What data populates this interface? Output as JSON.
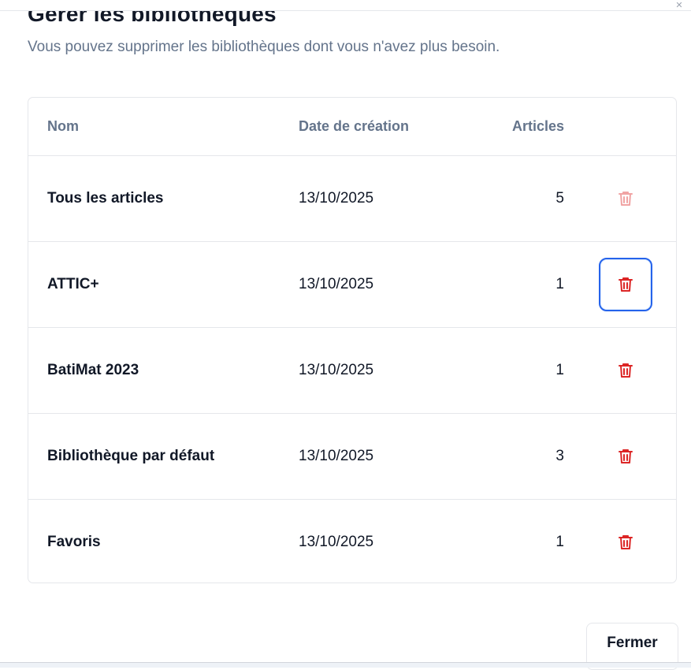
{
  "dialog": {
    "title": "Gérer les bibliothèques",
    "subtitle": "Vous pouvez supprimer les bibliothèques dont vous n'avez plus besoin."
  },
  "table": {
    "headers": {
      "name": "Nom",
      "created": "Date de création",
      "articles": "Articles"
    },
    "rows": [
      {
        "name": "Tous les articles",
        "created": "13/10/2025",
        "articles": "5",
        "delete_state": "disabled"
      },
      {
        "name": "ATTIC+",
        "created": "13/10/2025",
        "articles": "1",
        "delete_state": "focused"
      },
      {
        "name": "BatiMat 2023",
        "created": "13/10/2025",
        "articles": "1",
        "delete_state": "enabled"
      },
      {
        "name": "Bibliothèque par défaut",
        "created": "13/10/2025",
        "articles": "3",
        "delete_state": "enabled"
      },
      {
        "name": "Favoris",
        "created": "13/10/2025",
        "articles": "1",
        "delete_state": "enabled"
      }
    ]
  },
  "footer": {
    "close_label": "Fermer"
  },
  "icons": {
    "delete": "trash-icon",
    "close": "close-icon"
  },
  "colors": {
    "danger": "#dc2626",
    "focus": "#2563eb",
    "muted_text": "#64748b",
    "border": "#e5e7eb"
  }
}
